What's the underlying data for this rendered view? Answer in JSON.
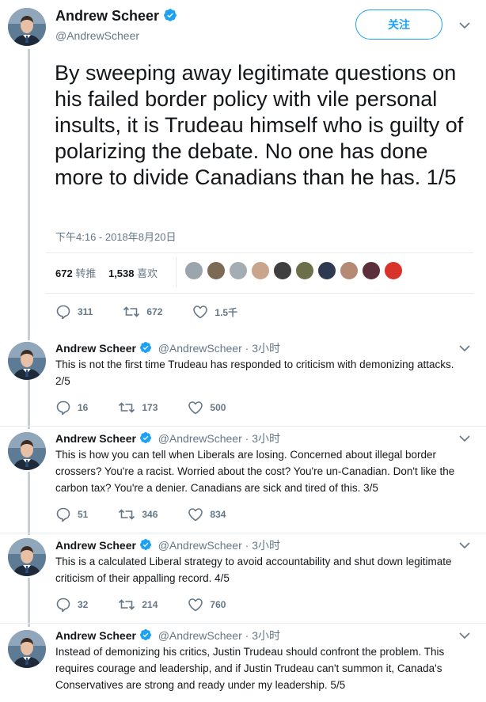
{
  "main": {
    "name": "Andrew Scheer",
    "handle": "@AndrewScheer",
    "follow_label": "关注",
    "text": "By sweeping away legitimate questions on his failed border policy with vile personal insults, it is Trudeau himself who is guilty of polarizing the debate. No one has done more to divide Canadians than he has. 1/5",
    "timestamp": "下午4:16 - 2018年8月20日",
    "retweets_count": "672",
    "retweets_label": "转推",
    "likes_count": "1,538",
    "likes_label": "喜欢",
    "replies": "311",
    "retweets": "672",
    "likes": "1.5千"
  },
  "replies": [
    {
      "name": "Andrew Scheer",
      "handle": "@AndrewScheer · 3小时",
      "text": "This is not the first time Trudeau has responded to criticism with demonizing attacks. 2/5",
      "replies": "16",
      "retweets": "173",
      "likes": "500"
    },
    {
      "name": "Andrew Scheer",
      "handle": "@AndrewScheer · 3小时",
      "text": "This is how you can tell when Liberals are losing. Concerned about illegal border crossers? You're a racist. Worried about the cost? You're un-Canadian. Don't like the carbon tax? You're a denier. Canadians are sick and tired of this. 3/5",
      "replies": "51",
      "retweets": "346",
      "likes": "834"
    },
    {
      "name": "Andrew Scheer",
      "handle": "@AndrewScheer · 3小时",
      "text": "This is a calculated Liberal strategy to avoid accountability and shut down legitimate criticism of their appalling record. 4/5",
      "replies": "32",
      "retweets": "214",
      "likes": "760"
    },
    {
      "name": "Andrew Scheer",
      "handle": "@AndrewScheer · 3小时",
      "text": "Instead of demonizing his critics, Justin Trudeau should confront the problem. This requires courage and leadership, and if Justin Trudeau can't summon it, Canada's Conservatives are strong and ready under my leadership. 5/5"
    }
  ],
  "colors": {
    "accent": "#1da1f2",
    "secondary_text": "#657786",
    "thread_line": "#c4cfd6"
  },
  "icons": [
    "verified-badge-icon",
    "chevron-down-icon",
    "reply-icon",
    "retweet-icon",
    "like-icon"
  ]
}
